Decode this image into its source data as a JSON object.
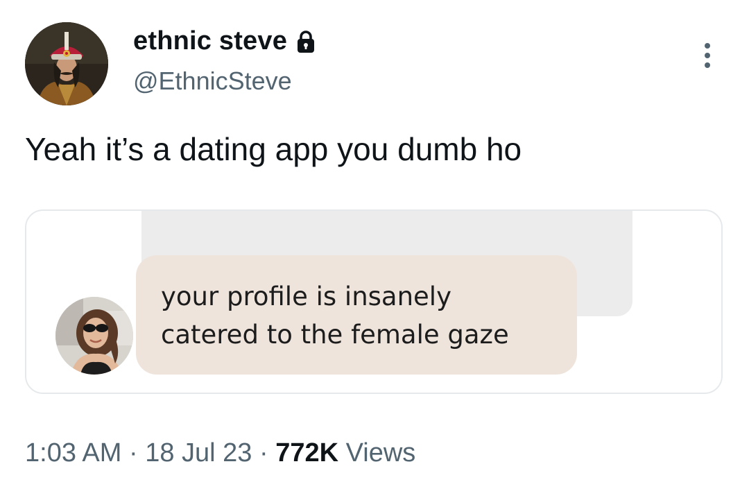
{
  "author": {
    "display_name": "ethnic steve",
    "handle": "@EthnicSteve",
    "avatar_icon": "user-avatar",
    "protected_icon": "lock-icon"
  },
  "menu": {
    "icon": "more-options-icon"
  },
  "tweet": {
    "text": "Yeah it’s a dating app you dumb ho"
  },
  "attachment": {
    "message_lines": [
      "your profile is insanely",
      "catered to the female gaze"
    ],
    "sender_avatar_icon": "sender-avatar",
    "colors": {
      "incoming_bubble": "#eee4dc",
      "outgoing_bubble": "#ececed"
    }
  },
  "meta": {
    "time": "1:03 AM",
    "separator": " · ",
    "date": "18 Jul 23",
    "views_count": "772K",
    "views_label": " Views"
  },
  "colors": {
    "text_primary": "#0f1419",
    "text_secondary": "#536471",
    "border": "#e6e9eb"
  }
}
